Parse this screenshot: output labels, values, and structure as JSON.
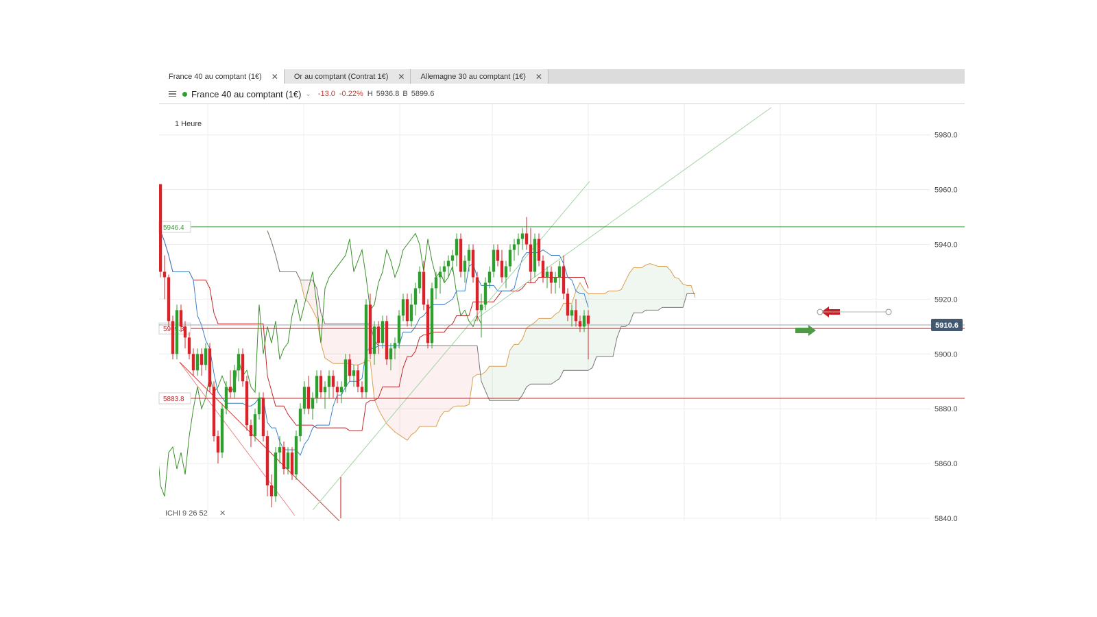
{
  "tabs": [
    {
      "label": "France 40 au comptant (1€)",
      "active": true
    },
    {
      "label": "Or au comptant (Contrat 1€)",
      "active": false
    },
    {
      "label": "Allemagne 30 au comptant (1€)",
      "active": false
    }
  ],
  "header": {
    "instrument": "France 40 au comptant (1€)",
    "change": "-13.0",
    "change_pct": "-0.22%",
    "high_label": "H",
    "high": "5936.8",
    "low_label": "B",
    "low": "5899.6"
  },
  "colors": {
    "up": "#2e9e2e",
    "down": "#d8232a",
    "tenkan": "#3a7fc8",
    "kijun": "#c0282a",
    "chikou": "#3a8f2a",
    "span_a": "#d9a050",
    "span_b": "#777777",
    "price_tag": "#43576d"
  },
  "chart_data": {
    "type": "candlestick",
    "timeframe": "1 Heure",
    "y_axis": {
      "min": 5840,
      "max": 5990,
      "ticks": [
        5840.0,
        5860.0,
        5880.0,
        5900.0,
        5920.0,
        5940.0,
        5960.0,
        5980.0
      ]
    },
    "current_price": "5910.6",
    "indicator": {
      "name": "ICHI",
      "params": [
        "9",
        "26",
        "52"
      ]
    },
    "horizontal_levels": [
      {
        "value": 5946.4,
        "label": "5946.4",
        "color": "#3a9a3a"
      },
      {
        "value": 5909.3,
        "label": "5909.3",
        "color": "#c0282a"
      },
      {
        "value": 5883.8,
        "label": "5883.8",
        "color": "#c0282a"
      }
    ],
    "candles": [
      [
        5962,
        5962,
        5928,
        5930
      ],
      [
        5930,
        5936,
        5920,
        5928
      ],
      [
        5928,
        5929,
        5910,
        5912
      ],
      [
        5912,
        5914,
        5898,
        5900
      ],
      [
        5900,
        5918,
        5898,
        5916
      ],
      [
        5916,
        5918,
        5908,
        5910
      ],
      [
        5910,
        5912,
        5902,
        5906
      ],
      [
        5906,
        5908,
        5898,
        5900
      ],
      [
        5900,
        5902,
        5892,
        5894
      ],
      [
        5894,
        5902,
        5892,
        5900
      ],
      [
        5900,
        5902,
        5892,
        5896
      ],
      [
        5896,
        5904,
        5894,
        5902
      ],
      [
        5902,
        5904,
        5886,
        5888
      ],
      [
        5888,
        5890,
        5868,
        5870
      ],
      [
        5870,
        5872,
        5860,
        5864
      ],
      [
        5864,
        5882,
        5862,
        5880
      ],
      [
        5880,
        5890,
        5878,
        5888
      ],
      [
        5888,
        5894,
        5884,
        5886
      ],
      [
        5886,
        5896,
        5884,
        5894
      ],
      [
        5894,
        5902,
        5890,
        5900
      ],
      [
        5900,
        5902,
        5888,
        5890
      ],
      [
        5890,
        5892,
        5872,
        5874
      ],
      [
        5874,
        5876,
        5866,
        5870
      ],
      [
        5870,
        5880,
        5868,
        5878
      ],
      [
        5878,
        5886,
        5876,
        5884
      ],
      [
        5884,
        5886,
        5868,
        5870
      ],
      [
        5870,
        5872,
        5848,
        5852
      ],
      [
        5852,
        5856,
        5844,
        5848
      ],
      [
        5848,
        5866,
        5846,
        5864
      ],
      [
        5864,
        5870,
        5860,
        5866
      ],
      [
        5866,
        5868,
        5856,
        5858
      ],
      [
        5858,
        5866,
        5856,
        5864
      ],
      [
        5864,
        5866,
        5854,
        5856
      ],
      [
        5856,
        5872,
        5854,
        5870
      ],
      [
        5870,
        5882,
        5868,
        5880
      ],
      [
        5880,
        5890,
        5878,
        5888
      ],
      [
        5888,
        5892,
        5878,
        5880
      ],
      [
        5880,
        5886,
        5876,
        5884
      ],
      [
        5884,
        5894,
        5882,
        5892
      ],
      [
        5892,
        5894,
        5884,
        5886
      ],
      [
        5886,
        5890,
        5880,
        5888
      ],
      [
        5888,
        5894,
        5884,
        5892
      ],
      [
        5892,
        5894,
        5884,
        5888
      ],
      [
        5888,
        5890,
        5882,
        5886
      ],
      [
        5886,
        5890,
        5882,
        5888
      ],
      [
        5888,
        5900,
        5886,
        5898
      ],
      [
        5898,
        5900,
        5890,
        5892
      ],
      [
        5892,
        5896,
        5888,
        5894
      ],
      [
        5894,
        5896,
        5886,
        5888
      ],
      [
        5888,
        5890,
        5884,
        5886
      ],
      [
        5886,
        5920,
        5884,
        5918
      ],
      [
        5918,
        5922,
        5898,
        5900
      ],
      [
        5900,
        5912,
        5896,
        5910
      ],
      [
        5910,
        5912,
        5900,
        5904
      ],
      [
        5904,
        5914,
        5902,
        5912
      ],
      [
        5912,
        5914,
        5896,
        5898
      ],
      [
        5898,
        5904,
        5894,
        5902
      ],
      [
        5902,
        5906,
        5898,
        5904
      ],
      [
        5904,
        5916,
        5902,
        5914
      ],
      [
        5914,
        5922,
        5912,
        5920
      ],
      [
        5920,
        5922,
        5910,
        5912
      ],
      [
        5912,
        5922,
        5910,
        5918
      ],
      [
        5918,
        5926,
        5914,
        5924
      ],
      [
        5924,
        5932,
        5922,
        5930
      ],
      [
        5930,
        5934,
        5916,
        5918
      ],
      [
        5918,
        5920,
        5902,
        5904
      ],
      [
        5904,
        5926,
        5902,
        5924
      ],
      [
        5924,
        5930,
        5920,
        5928
      ],
      [
        5928,
        5932,
        5922,
        5930
      ],
      [
        5930,
        5934,
        5926,
        5932
      ],
      [
        5932,
        5936,
        5928,
        5934
      ],
      [
        5934,
        5938,
        5930,
        5936
      ],
      [
        5936,
        5944,
        5932,
        5942
      ],
      [
        5942,
        5944,
        5928,
        5930
      ],
      [
        5930,
        5936,
        5926,
        5934
      ],
      [
        5934,
        5940,
        5930,
        5938
      ],
      [
        5938,
        5940,
        5926,
        5928
      ],
      [
        5928,
        5930,
        5912,
        5916
      ],
      [
        5916,
        5922,
        5906,
        5918
      ],
      [
        5918,
        5928,
        5916,
        5926
      ],
      [
        5926,
        5932,
        5924,
        5930
      ],
      [
        5930,
        5940,
        5928,
        5938
      ],
      [
        5938,
        5940,
        5932,
        5934
      ],
      [
        5934,
        5938,
        5926,
        5928
      ],
      [
        5928,
        5934,
        5924,
        5932
      ],
      [
        5932,
        5940,
        5930,
        5938
      ],
      [
        5938,
        5942,
        5934,
        5940
      ],
      [
        5940,
        5944,
        5936,
        5942
      ],
      [
        5942,
        5946,
        5938,
        5944
      ],
      [
        5944,
        5950,
        5938,
        5940
      ],
      [
        5940,
        5946,
        5926,
        5930
      ],
      [
        5930,
        5944,
        5928,
        5942
      ],
      [
        5942,
        5944,
        5932,
        5934
      ],
      [
        5934,
        5936,
        5926,
        5928
      ],
      [
        5928,
        5932,
        5924,
        5930
      ],
      [
        5930,
        5932,
        5922,
        5926
      ],
      [
        5926,
        5930,
        5922,
        5928
      ],
      [
        5928,
        5934,
        5924,
        5932
      ],
      [
        5932,
        5936,
        5920,
        5922
      ],
      [
        5922,
        5924,
        5912,
        5914
      ],
      [
        5914,
        5918,
        5910,
        5916
      ],
      [
        5916,
        5920,
        5910,
        5912
      ],
      [
        5912,
        5914,
        5908,
        5910
      ],
      [
        5910,
        5916,
        5908,
        5914
      ],
      [
        5914,
        5916,
        5898,
        5911
      ]
    ]
  },
  "markers": {
    "sell_arrow": "sell-arrow-icon",
    "buy_arrow": "buy-arrow-icon"
  }
}
